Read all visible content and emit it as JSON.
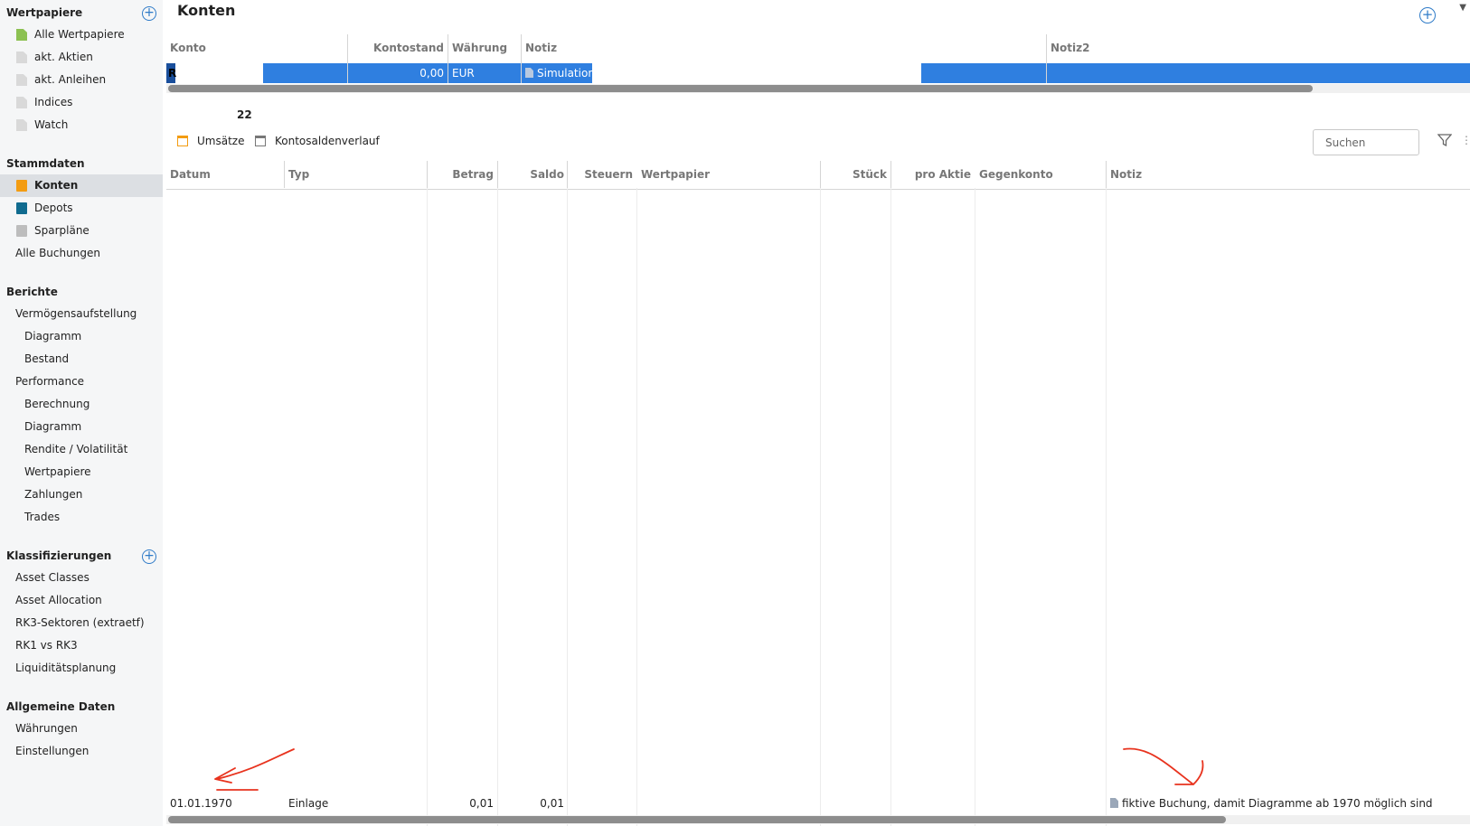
{
  "sidebar": {
    "wertpapiere": {
      "title": "Wertpapiere",
      "items": [
        "Alle Wertpapiere",
        "akt. Aktien",
        "akt. Anleihen",
        "Indices",
        "Watch"
      ]
    },
    "stammdaten": {
      "title": "Stammdaten",
      "items": [
        "Konten",
        "Depots",
        "Sparpläne",
        "Alle Buchungen"
      ]
    },
    "berichte": {
      "title": "Berichte",
      "items": [
        "Vermögensaufstellung",
        "Diagramm",
        "Bestand",
        "Performance",
        "Berechnung",
        "Diagramm",
        "Rendite / Volatilität",
        "Wertpapiere",
        "Zahlungen",
        "Trades"
      ]
    },
    "klassifizierungen": {
      "title": "Klassifizierungen",
      "items": [
        "Asset Classes",
        "Asset Allocation",
        "RK3-Sektoren (extraetf)",
        "RK1 vs RK3",
        "Liquiditätsplanung"
      ]
    },
    "allgemein": {
      "title": "Allgemeine Daten",
      "items": [
        "Währungen",
        "Einstellungen"
      ]
    }
  },
  "main": {
    "title": "Konten",
    "accounts_table": {
      "columns": [
        "Konto",
        "Kontostand",
        "Währung",
        "Notiz",
        "Notiz2"
      ],
      "rows": [
        {
          "konto": "R",
          "kontostand": "0,00",
          "waehrung": "EUR",
          "notiz": "Simulation",
          "notiz2": ""
        }
      ]
    },
    "detail": {
      "title": "22",
      "tabs": [
        "Umsätze",
        "Kontosaldenverlauf"
      ],
      "search_placeholder": "Suchen",
      "columns": [
        "Datum",
        "Typ",
        "Betrag",
        "Saldo",
        "Steuern",
        "Wertpapier",
        "Stück",
        "pro Aktie",
        "Gegenkonto",
        "Notiz"
      ],
      "rows": [
        {
          "datum": "01.01.1970",
          "typ": "Einlage",
          "betrag": "0,01",
          "saldo": "0,01",
          "steuern": "",
          "wertpapier": "",
          "stueck": "",
          "pro_aktie": "",
          "gegenkonto": "",
          "notiz": "fiktive Buchung, damit Diagramme ab 1970 möglich sind"
        }
      ]
    }
  },
  "colors": {
    "selection": "#2f7fe0",
    "accent": "#2f7bc8",
    "annotation": "#e8331e"
  },
  "icons": [
    "plus-circle-icon",
    "document-icon",
    "account-icon",
    "depot-icon",
    "savings-plan-icon",
    "filter-icon",
    "note-icon",
    "tab-table-icon"
  ]
}
